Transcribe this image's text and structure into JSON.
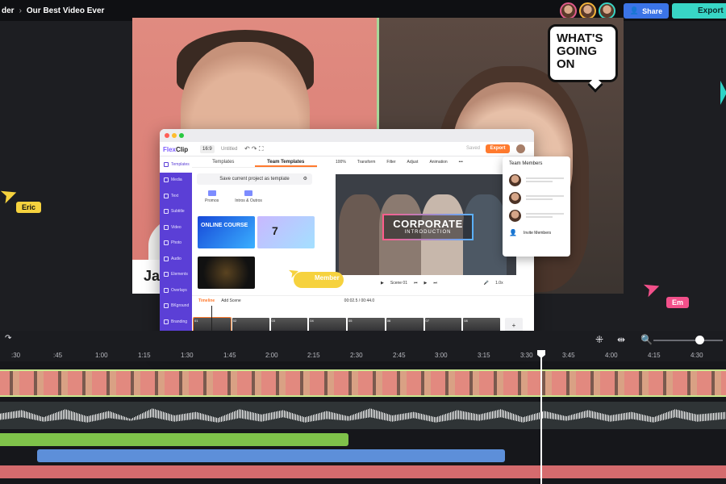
{
  "header": {
    "breadcrumb_parent": "der",
    "project_title": "Our Best Video Ever",
    "share_label": "Share",
    "export_label": "Export"
  },
  "stage": {
    "name_plate": "Ja",
    "bubble_text": "WHAT'S GOING ON",
    "cursor_eric": "Eric",
    "cursor_em": "Em",
    "cursor_member": "Member"
  },
  "app": {
    "logo_a": "Flex",
    "logo_b": "Clip",
    "ratio": "16:9",
    "untitled": "Untitled",
    "saved": "Saved",
    "export": "Export",
    "sidebar": [
      "Templates",
      "Media",
      "Text",
      "Subtitle",
      "Video",
      "Photo",
      "Audio",
      "Elements",
      "Overlays",
      "BKground",
      "Branding"
    ],
    "panel_tabs": [
      "Templates",
      "Team Templates"
    ],
    "save_template": "Save current project as template",
    "folders": [
      "Promos",
      "Intros & Outros"
    ],
    "thumb1_text": "ONLINE COURSE",
    "thumb2_text": "7",
    "toolbar_items": [
      "100%",
      "Transform",
      "Filter",
      "Adjust",
      "Animation"
    ],
    "corp_title": "CORPORATE",
    "corp_sub": "INTRODUCTION",
    "scene_label": "Scene 01",
    "speed": "1.0x",
    "timeline_label": "Timeline",
    "add_scene": "Add Scene",
    "time": "00:02.5 / 00:44.0"
  },
  "team": {
    "title": "Team Members",
    "invite": "Invite Members"
  },
  "ruler": [
    ":30",
    ":45",
    "1:00",
    "1:15",
    "1:30",
    "1:45",
    "2:00",
    "2:15",
    "2:30",
    "2:45",
    "3:00",
    "3:15",
    "3:30",
    "3:45",
    "4:00",
    "4:15",
    "4:30"
  ]
}
